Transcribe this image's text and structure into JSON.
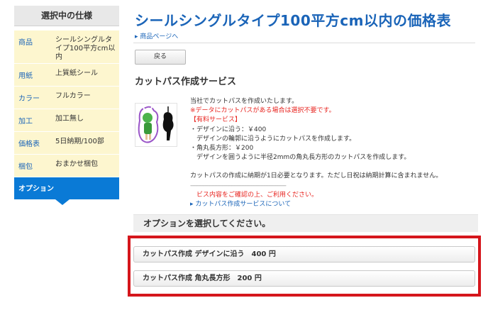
{
  "sidebar": {
    "title": "選択中の仕様",
    "rows": [
      {
        "key": "商品",
        "value": "シールシングルタイプ100平方cm以内"
      },
      {
        "key": "用紙",
        "value": "上質紙シール"
      },
      {
        "key": "カラー",
        "value": "フルカラー"
      },
      {
        "key": "加工",
        "value": "加工無し"
      },
      {
        "key": "価格表",
        "value": "5日納期/100部"
      },
      {
        "key": "梱包",
        "value": "おまかせ梱包"
      }
    ],
    "active": "オプション"
  },
  "main": {
    "title": "シールシングルタイプ100平方cm以内の価格表",
    "product_link": "▸ 商品ページへ",
    "back_button": "戻る",
    "service_title": "カットパス作成サービス",
    "service_lines": {
      "l1": "当社でカットパスを作成いたします。",
      "l2": "※データにカットパスがある場合は選択不要です。",
      "l3": "【有料サービス】",
      "l4": "・デザインに沿う：￥400",
      "l5": "　デザインの輪郭に沿うようにカットパスを作成します。",
      "l6": "・角丸長方形：￥200",
      "l7": "　デザインを囲うように半径2mmの角丸長方形のカットパスを作成します。",
      "l8": "カットパスの作成に納期が1日必要となります。ただし日祝は納期計算に含まれません。",
      "l9": "------------------------------------------------------------",
      "l10": "　ビス内容をご確認の上、ご利用ください。",
      "l11": "▸ カットパス作成サービスについて"
    },
    "options_heading": "オプションを選択してください。",
    "options": [
      {
        "label": "カットパス作成 デザインに沿う　400 円"
      },
      {
        "label": "カットパス作成 角丸長方形　200 円"
      }
    ]
  },
  "colors": {
    "accent": "#1a64b8",
    "active": "#0a7ad6",
    "highlight": "#d5161c",
    "warning": "#e8241f"
  }
}
